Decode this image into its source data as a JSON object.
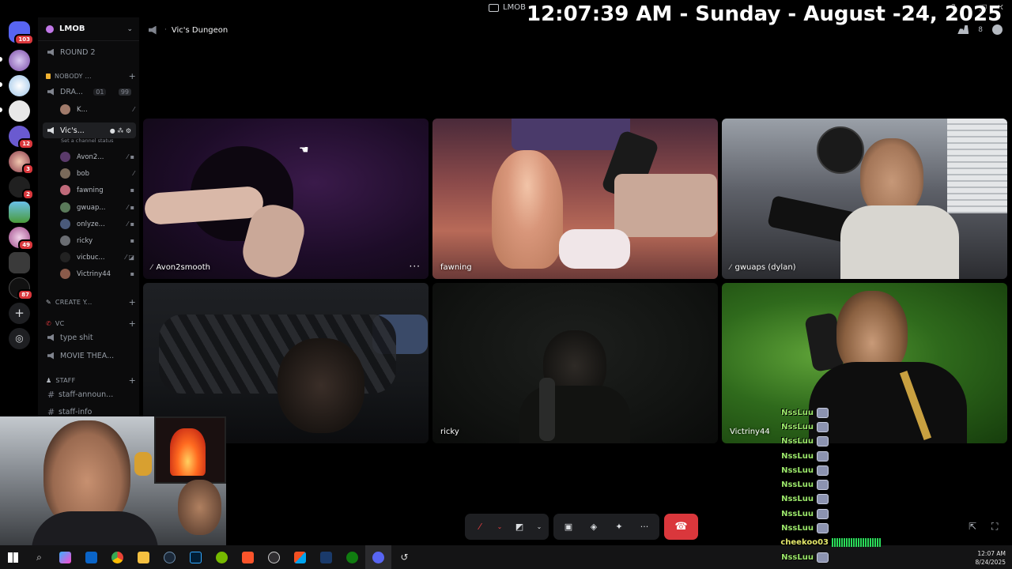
{
  "window": {
    "app_title": "LMOB",
    "clock_overlay": "12:07:39 AM - Sunday - August -24, 2025"
  },
  "rail": {
    "badges": [
      "103",
      "12",
      "3",
      "2",
      "49",
      "87"
    ]
  },
  "sidebar": {
    "guild_name": "LMOB",
    "round_label": "ROUND 2",
    "cat_nobody": "NOBODY ...",
    "dra_label": "DRA...",
    "dra_count_a": "01",
    "dra_count_b": "99",
    "k_member": "K...",
    "active_channel": "Vic's...",
    "channel_status": "Set a channel status",
    "members": [
      "Avon2...",
      "bob",
      "fawning",
      "gwuap...",
      "onlyze...",
      "ricky",
      "vicbuc...",
      "Victriny44"
    ],
    "cat_create": "CREATE Y...",
    "cat_vc": "VC",
    "ch_type": "type shit",
    "ch_movie": "MOVIE THEA...",
    "cat_staff": "STAFF",
    "ch_staff_ann": "staff-announ...",
    "ch_staff_info": "staff-info"
  },
  "header": {
    "channel_name": "Vic's Dungeon",
    "member_count": "8"
  },
  "tiles": {
    "t1_name": "Avon2smooth",
    "t2_name": "fawning",
    "t3_name": "gwuaps (dylan)",
    "t5_name": "ricky",
    "t6_name": "Victriny44"
  },
  "chat": {
    "messages": [
      "NssLuu",
      "NssLuu",
      "NssLuu",
      "NssLuu",
      "NssLuu",
      "NssLuu",
      "NssLuu",
      "NssLuu",
      "NssLuu",
      "cheekoo03",
      "NssLuu"
    ]
  },
  "tray": {
    "time": "12:07 AM",
    "date": "8/24/2025"
  },
  "colors": {
    "hangup": "#da373c",
    "badge": "#da373c",
    "chat_name": "#9be66a"
  }
}
